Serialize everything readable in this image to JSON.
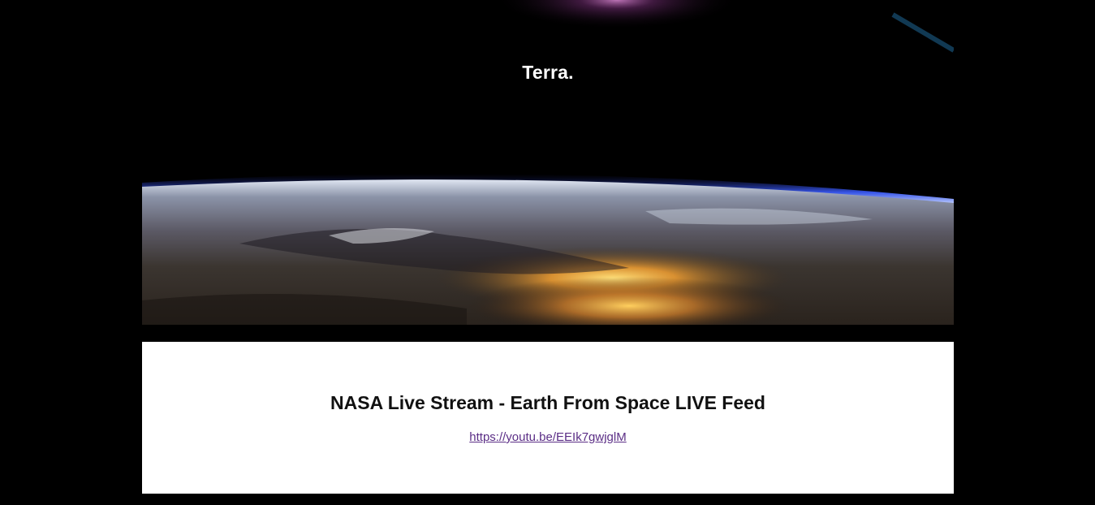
{
  "site": {
    "logo_text": "Terra."
  },
  "hero": {
    "image_description_icon": "earth-horizon-image"
  },
  "post": {
    "title": "NASA Live Stream - Earth From Space LIVE Feed",
    "link_text": "https://youtu.be/EEIk7gwjglM",
    "link_href": "https://youtu.be/EEIk7gwjglM"
  },
  "colors": {
    "background": "#000000",
    "card_background": "#ffffff",
    "link": "#5b2e86",
    "title": "#111111"
  }
}
